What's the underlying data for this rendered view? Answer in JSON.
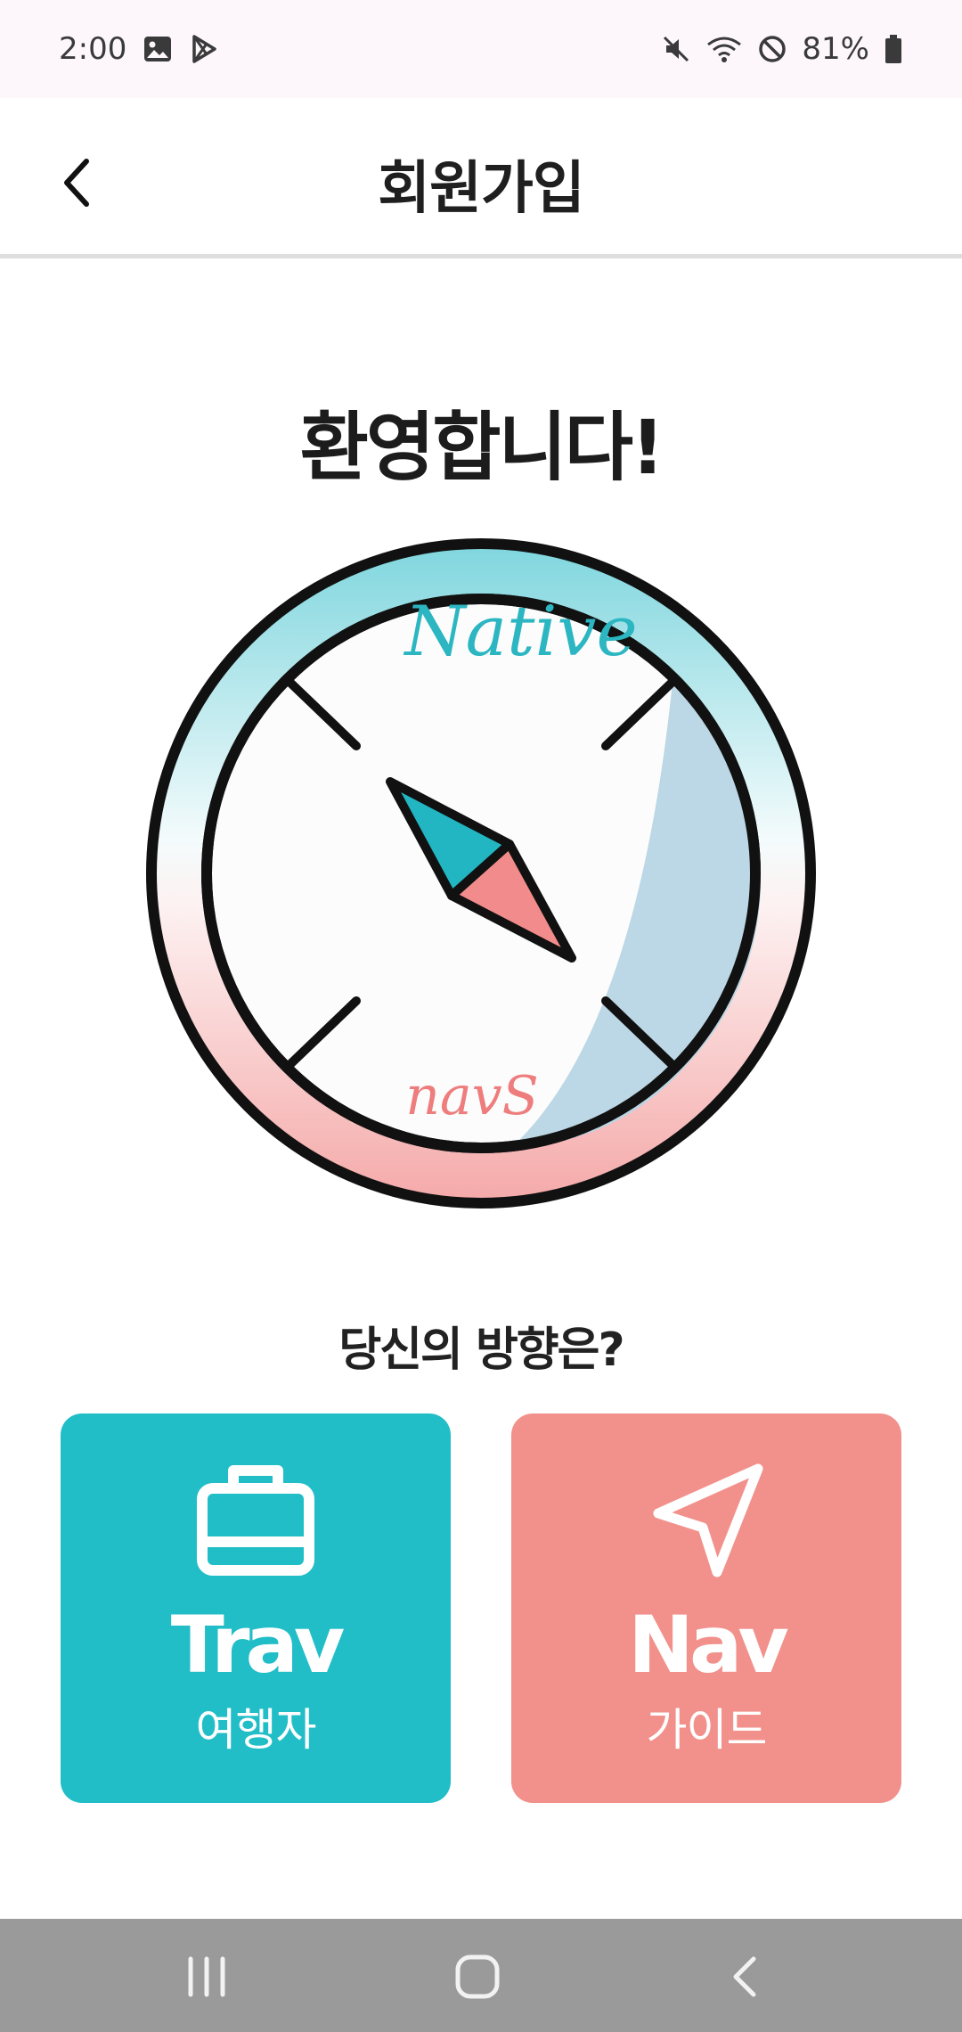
{
  "status_bar": {
    "time": "2:00",
    "battery": "81%",
    "icons": [
      "gallery-icon",
      "play-store-icon",
      "mute-icon",
      "wifi-icon",
      "do-not-disturb-icon",
      "battery-icon"
    ]
  },
  "header": {
    "title": "회원가입",
    "back_icon": "chevron-left-icon"
  },
  "main": {
    "welcome": "환영합니다!",
    "logo": {
      "top_text": "Native",
      "bottom_text": "navS"
    },
    "question": "당신의 방향은?",
    "roles": [
      {
        "title": "Trav",
        "subtitle": "여행자",
        "icon": "briefcase-icon",
        "color": "#22bec8"
      },
      {
        "title": "Nav",
        "subtitle": "가이드",
        "icon": "navigation-arrow-icon",
        "color": "#f2918b"
      }
    ]
  },
  "nav_bar": {
    "buttons": [
      "recent-apps-icon",
      "home-icon",
      "back-icon"
    ]
  },
  "colors": {
    "teal": "#22bec8",
    "coral": "#f2918b",
    "navbar": "#9a9a9a",
    "statusbar": "#fdf7fc"
  }
}
